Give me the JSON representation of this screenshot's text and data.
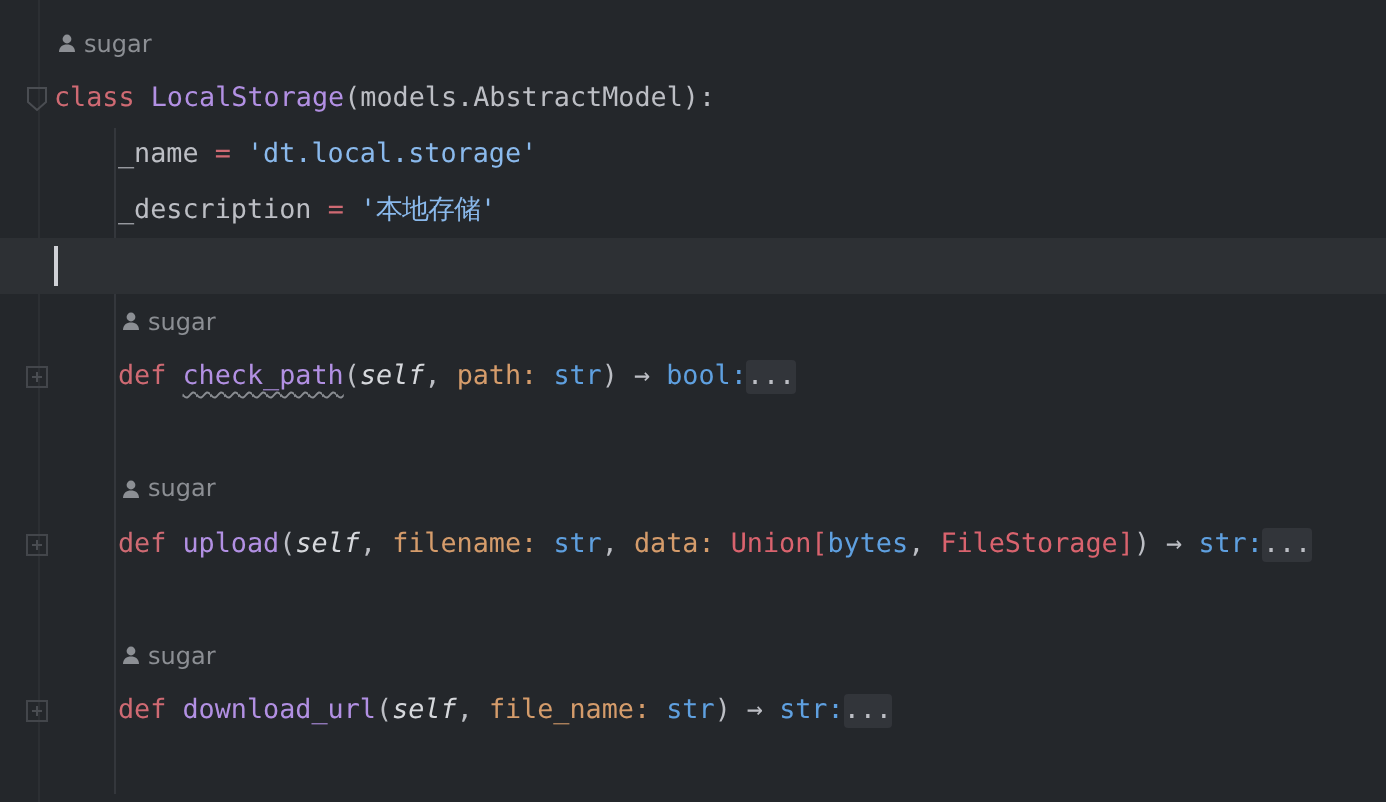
{
  "editor": {
    "lines": [
      {
        "kind": "author_hint",
        "author": "sugar"
      },
      {
        "kind": "code",
        "collapsed": false,
        "current": false,
        "tokens": [
          {
            "kind": "keyword",
            "text": "class "
          },
          {
            "kind": "class_name",
            "text": "LocalStorage"
          },
          {
            "kind": "plain",
            "text": "(models.AbstractModel):"
          }
        ],
        "children": [
          {
            "kind": "code",
            "current": false,
            "tokens": [
              {
                "kind": "plain",
                "text": "_name "
              },
              {
                "kind": "operator",
                "text": "= "
              },
              {
                "kind": "string",
                "text": "'dt.local.storage'"
              }
            ]
          },
          {
            "kind": "code",
            "current": false,
            "tokens": [
              {
                "kind": "plain",
                "text": "_description "
              },
              {
                "kind": "operator",
                "text": "= "
              },
              {
                "kind": "string",
                "text": "'本地存储'"
              }
            ]
          }
        ]
      },
      {
        "kind": "code",
        "current": true
      },
      {
        "kind": "group",
        "children": [
          {
            "kind": "author_hint",
            "author": "sugar"
          },
          {
            "kind": "code",
            "collapsed": true,
            "current": false,
            "tokens": [
              {
                "kind": "keyword",
                "text": "def "
              },
              {
                "kind": "function_warning",
                "text": "check_path"
              },
              {
                "kind": "plain",
                "text": "("
              },
              {
                "kind": "self",
                "text": "self"
              },
              {
                "kind": "plain",
                "text": ", "
              },
              {
                "kind": "param",
                "text": "path: "
              },
              {
                "kind": "type",
                "text": "str"
              },
              {
                "kind": "plain",
                "text": ") → "
              },
              {
                "kind": "type",
                "text": "bool:"
              },
              {
                "kind": "folded",
                "text": "..."
              }
            ]
          },
          {
            "kind": "code",
            "current": false
          },
          {
            "kind": "author_hint",
            "author": "sugar"
          },
          {
            "kind": "code",
            "collapsed": true,
            "current": false,
            "tokens": [
              {
                "kind": "keyword",
                "text": "def "
              },
              {
                "kind": "function",
                "text": "upload"
              },
              {
                "kind": "plain",
                "text": "("
              },
              {
                "kind": "self",
                "text": "self"
              },
              {
                "kind": "plain",
                "text": ", "
              },
              {
                "kind": "param",
                "text": "filename: "
              },
              {
                "kind": "type",
                "text": "str"
              },
              {
                "kind": "plain",
                "text": ", "
              },
              {
                "kind": "param",
                "text": "data: "
              },
              {
                "kind": "class_ref",
                "text": "Union["
              },
              {
                "kind": "type",
                "text": "bytes"
              },
              {
                "kind": "plain",
                "text": ", "
              },
              {
                "kind": "class_ref",
                "text": "FileStorage]"
              },
              {
                "kind": "plain",
                "text": ") → "
              },
              {
                "kind": "type",
                "text": "str:"
              },
              {
                "kind": "folded",
                "text": "..."
              }
            ]
          },
          {
            "kind": "code",
            "current": false
          },
          {
            "kind": "author_hint",
            "author": "sugar"
          },
          {
            "kind": "code",
            "collapsed": true,
            "current": false,
            "tokens": [
              {
                "kind": "keyword",
                "text": "def "
              },
              {
                "kind": "function",
                "text": "download_url"
              },
              {
                "kind": "plain",
                "text": "("
              },
              {
                "kind": "self",
                "text": "self"
              },
              {
                "kind": "plain",
                "text": ", "
              },
              {
                "kind": "param",
                "text": "file_name: "
              },
              {
                "kind": "type",
                "text": "str"
              },
              {
                "kind": "plain",
                "text": ") → "
              },
              {
                "kind": "type",
                "text": "str:"
              },
              {
                "kind": "folded",
                "text": "..."
              }
            ]
          },
          {
            "kind": "code",
            "current": false
          }
        ]
      }
    ]
  }
}
